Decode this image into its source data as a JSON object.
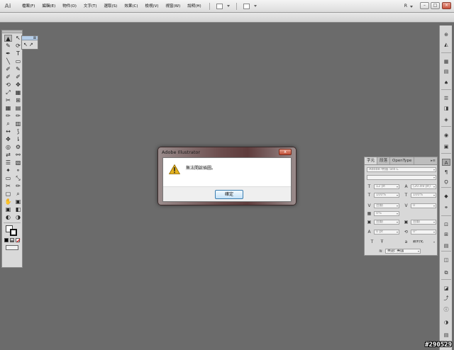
{
  "menubar": {
    "logo": "Ai",
    "menus": [
      "檔案(F)",
      "編輯(E)",
      "物件(O)",
      "文字(T)",
      "選取(S)",
      "效果(C)",
      "檢視(V)",
      "視窗(W)",
      "說明(H)"
    ],
    "workspace_label": "R"
  },
  "tools": {
    "flyout_close": "⊠",
    "left_column": [
      "▲",
      "✎",
      "✒",
      "╲",
      "✐",
      "✐",
      "⟲",
      "⤢",
      "✂",
      "▦",
      "✏",
      "⌕",
      "↔",
      "✥",
      "◎",
      "⇄",
      "☰",
      "✦",
      "▭",
      "✂",
      "▢",
      "✋",
      "▣",
      "◐"
    ],
    "right_column": [
      "↖",
      "⟳",
      "T",
      "▭",
      "✎",
      "✐",
      "✥",
      "▦",
      "⊞",
      "▤",
      "✏",
      "▥",
      "⟆",
      "⇂",
      "⚙",
      "⚯",
      "▧",
      "⚬",
      "⤡",
      "✏",
      "⌕",
      "▣",
      "◧",
      "◑"
    ]
  },
  "dialog": {
    "title": "Adobe Illustrator",
    "message": "無法開啟插圖。",
    "ok_label": "確定",
    "close_label": "x"
  },
  "character_panel": {
    "tabs": [
      "字元",
      "段落",
      "OpenType"
    ],
    "menu_icon": "▸≡",
    "font_family": "Adobe 明體 Std L",
    "font_style": "",
    "font_size": "12 pt",
    "leading": "(20.89 pt)",
    "vertical_scale": "100%",
    "horizontal_scale": "100%",
    "kerning": "自動",
    "tracking": "0",
    "tsume": "0%",
    "aki_left": "自動",
    "aki_right": "自動",
    "baseline_shift": "0 pt",
    "rotation": "0°",
    "underline_icon": "T",
    "strike_icon": "Ŧ",
    "anti_alias": "銳利化",
    "language": "英語: 美國"
  },
  "dock": {
    "icons": [
      "⊕",
      "◭",
      "▦",
      "▤",
      "♠",
      "☰",
      "◨",
      "◈",
      "◉",
      "▣",
      "A",
      "¶",
      "Ọ",
      "◆",
      "⚭",
      "⊡",
      "⊞",
      "▤",
      "◫",
      "⧉",
      "◪",
      "⤴",
      "ⓘ",
      "◑",
      "▤"
    ]
  },
  "watermark": "#290529",
  "colors": {
    "canvas": "#6b6b6b",
    "panel": "#d8d8d8",
    "dialog_frame": "#6c4d4d",
    "ok_border": "#3c7fb1",
    "warning": "#e3b11f"
  }
}
